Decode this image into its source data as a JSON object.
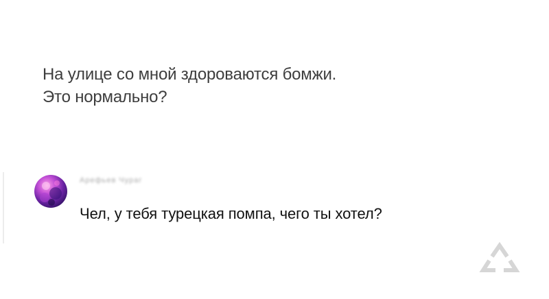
{
  "post": {
    "line1": "На улице со мной здороваются бомжи.",
    "line2": "Это нормально?"
  },
  "comment": {
    "username": "Арефьев Чураг",
    "text": "Чел, у тебя турецкая помпа, чего ты хотел?"
  },
  "colors": {
    "post_text": "#3d3d3d",
    "comment_text": "#111111",
    "username": "#a8a8a8",
    "logo": "#d6d6d6"
  },
  "icons": {
    "avatar": "avatar-image",
    "watermark": "triangle-logo-icon"
  }
}
